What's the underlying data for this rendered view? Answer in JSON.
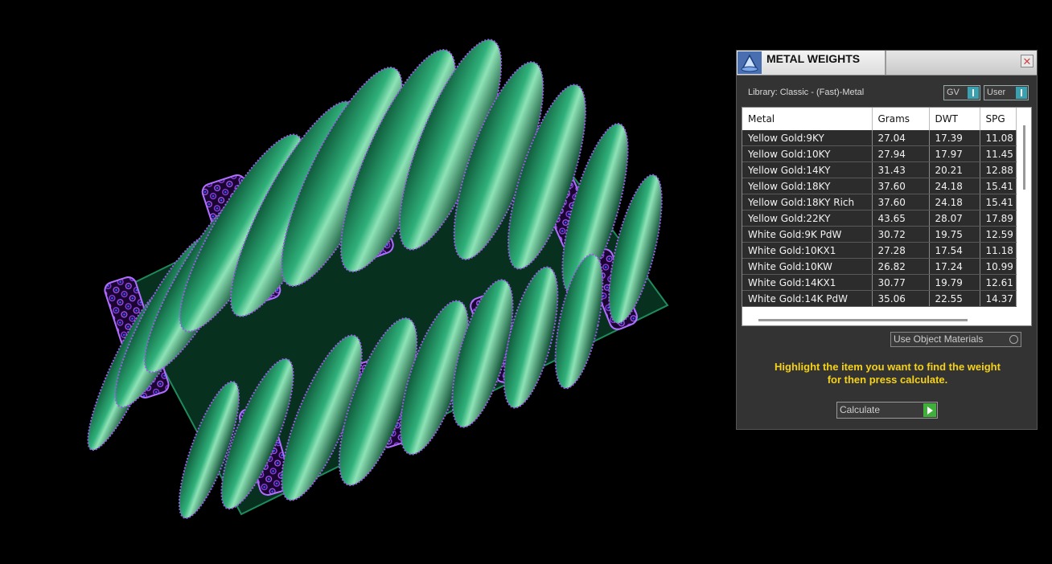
{
  "panel": {
    "title": "METAL WEIGHTS",
    "close_glyph": "✕",
    "library_label": "Library: Classic - (Fast)-Metal",
    "toggle_gv": "GV",
    "toggle_user": "User",
    "use_object_materials": "Use Object Materials",
    "instruction_line1": "Highlight the item you want to find the weight",
    "instruction_line2": "for then press calculate.",
    "calculate_label": "Calculate"
  },
  "table": {
    "headers": [
      "Metal",
      "Grams",
      "DWT",
      "SPG"
    ],
    "rows": [
      [
        "Yellow Gold:9KY",
        "27.04",
        "17.39",
        "11.08"
      ],
      [
        "Yellow Gold:10KY",
        "27.94",
        "17.97",
        "11.45"
      ],
      [
        "Yellow Gold:14KY",
        "31.43",
        "20.21",
        "12.88"
      ],
      [
        "Yellow Gold:18KY",
        "37.60",
        "24.18",
        "15.41"
      ],
      [
        "Yellow Gold:18KY Rich",
        "37.60",
        "24.18",
        "15.41"
      ],
      [
        "Yellow Gold:22KY",
        "43.65",
        "28.07",
        "17.89"
      ],
      [
        "White Gold:9K PdW",
        "30.72",
        "19.75",
        "12.59"
      ],
      [
        "White Gold:10KX1",
        "27.28",
        "17.54",
        "11.18"
      ],
      [
        "White Gold:10KW",
        "26.82",
        "17.24",
        "10.99"
      ],
      [
        "White Gold:14KX1",
        "30.77",
        "19.79",
        "12.61"
      ],
      [
        "White Gold:14K PdW",
        "35.06",
        "22.55",
        "14.37"
      ]
    ]
  },
  "icons": {
    "app": "metal-weights-app-icon",
    "close": "close-icon",
    "toggle": "toggle-icon",
    "radio": "radio-icon",
    "play": "play-icon"
  },
  "colors": {
    "accent_yellow": "#f5d21a",
    "toggle_teal": "#3aa1b0",
    "calculate_green": "#3fae3a",
    "model_green": "#1f8a5c",
    "model_purple": "#7a2fc8"
  }
}
